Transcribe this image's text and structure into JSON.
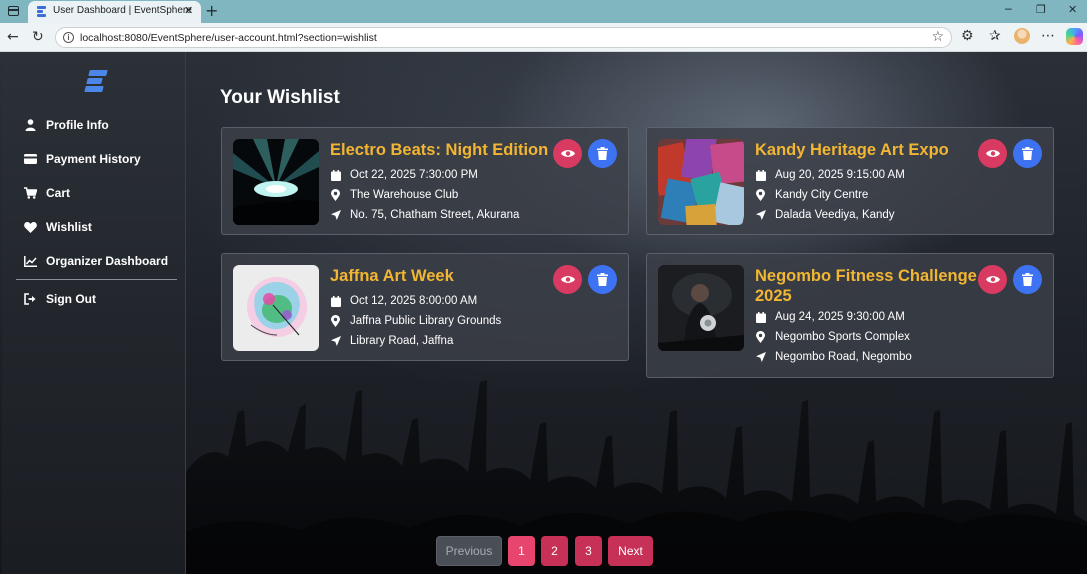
{
  "browser": {
    "tab_title": "User Dashboard | EventSphere",
    "tab_close": "✕",
    "new_tab": "+",
    "url": "localhost:8080/EventSphere/user-account.html?section=wishlist",
    "info_glyph": "i",
    "icons": [
      "sidebar-toggle-icon",
      "favicon-icon",
      "back-icon",
      "reload-icon",
      "info-icon",
      "star-icon",
      "extensions-icon",
      "favorites-icon",
      "profile-avatar",
      "more-icon",
      "copilot-icon",
      "minimize-icon",
      "restore-icon",
      "close-window-icon"
    ]
  },
  "sidebar": {
    "brand_color": "#4b86e8",
    "items": [
      {
        "label": "Profile Info",
        "icon": "user-icon"
      },
      {
        "label": "Payment History",
        "icon": "credit-card-icon"
      },
      {
        "label": "Cart",
        "icon": "cart-icon"
      },
      {
        "label": "Wishlist",
        "icon": "heart-icon"
      },
      {
        "label": "Organizer Dashboard",
        "icon": "chart-line-icon"
      }
    ],
    "sign_out": {
      "label": "Sign Out",
      "icon": "sign-out-icon"
    }
  },
  "main": {
    "title": "Your Wishlist",
    "accent_color": "#f2b632",
    "view_button_color": "#d93a61",
    "delete_button_color": "#3d73f2",
    "cards": [
      {
        "name": "Electro Beats: Night Edition",
        "datetime": "Oct 22, 2025 7:30:00 PM",
        "venue": "The Warehouse Club",
        "address": "No. 75, Chatham Street, Akurana",
        "image": "concert-stage-image"
      },
      {
        "name": "Kandy Heritage Art Expo",
        "datetime": "Aug 20, 2025 9:15:00 AM",
        "venue": "Kandy City Centre",
        "address": "Dalada Veediya, Kandy",
        "image": "colorful-textiles-image"
      },
      {
        "name": "Jaffna Art Week",
        "datetime": "Oct 12, 2025 8:00:00 AM",
        "venue": "Jaffna Public Library Grounds",
        "address": "Library Road, Jaffna",
        "image": "abstract-art-image"
      },
      {
        "name": "Negombo Fitness Challenge 2025",
        "datetime": "Aug 24, 2025 9:30:00 AM",
        "venue": "Negombo Sports Complex",
        "address": "Negombo Road, Negombo",
        "image": "boxer-image"
      }
    ]
  },
  "pagination": {
    "previous": "Previous",
    "pages": [
      "1",
      "2",
      "3"
    ],
    "current": "1",
    "next": "Next",
    "active_color": "#e8456e",
    "page_color": "#c73057"
  }
}
